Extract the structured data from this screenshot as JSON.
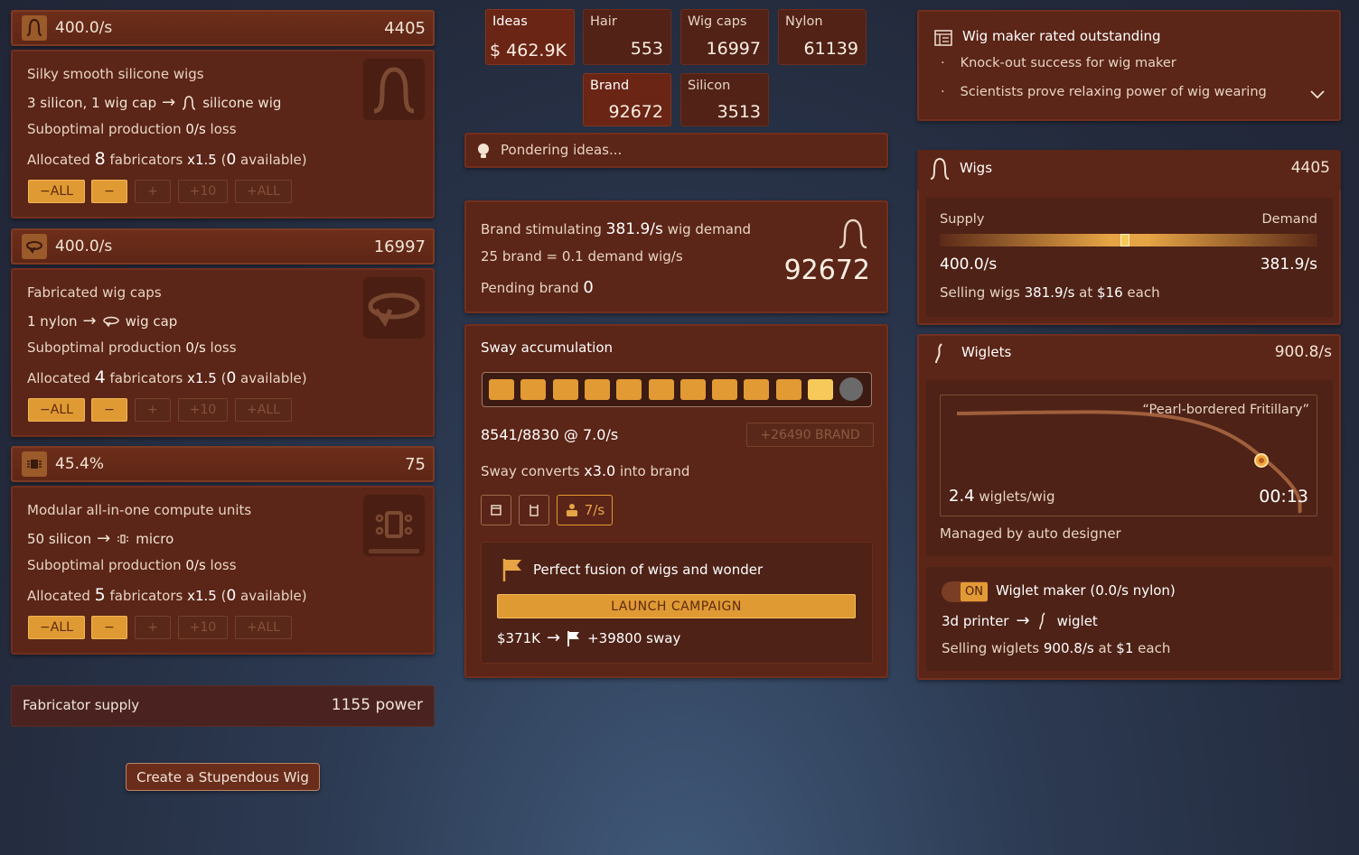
{
  "silicone": {
    "rate": "400.0/s",
    "count": "4405",
    "title": "Silky smooth silicone wigs",
    "recipe_left": "3 silicon, 1 wig cap",
    "recipe_right": "silicone wig",
    "subopt_a": "Suboptimal production ",
    "subopt_b": "0/s",
    "subopt_c": " loss",
    "alloc_a": "Allocated ",
    "alloc_n": "8",
    "alloc_b": " fabricators ",
    "alloc_x": "x1.5",
    "alloc_c": " (",
    "alloc_av": "0",
    "alloc_d": " available)"
  },
  "wigcap": {
    "rate": "400.0/s",
    "count": "16997",
    "title": "Fabricated wig caps",
    "recipe_left": "1 nylon",
    "recipe_right": "wig cap",
    "subopt_a": "Suboptimal production ",
    "subopt_b": "0/s",
    "subopt_c": " loss",
    "alloc_a": "Allocated ",
    "alloc_n": "4",
    "alloc_b": " fabricators ",
    "alloc_x": "x1.5",
    "alloc_c": " (",
    "alloc_av": "0",
    "alloc_d": " available)"
  },
  "micro": {
    "rate": "45.4%",
    "count": "75",
    "title": "Modular all-in-one compute units",
    "recipe_left": "50 silicon",
    "recipe_right": "micro",
    "subopt_a": "Suboptimal production ",
    "subopt_b": "0/s",
    "subopt_c": " loss",
    "alloc_a": "Allocated ",
    "alloc_n": "5",
    "alloc_b": " fabricators ",
    "alloc_x": "x1.5",
    "alloc_c": " (",
    "alloc_av": "0",
    "alloc_d": " available)"
  },
  "buttons": {
    "minus_all": "−ALL",
    "minus": "−",
    "plus": "+",
    "plus10": "+10",
    "plus_all": "+ALL"
  },
  "fab_supply": {
    "label": "Fabricator supply",
    "value": "1155 power"
  },
  "create_wig": "Create a Stupendous Wig",
  "resources": {
    "ideas": {
      "label": "Ideas",
      "value": "$ 462.9K"
    },
    "hair": {
      "label": "Hair",
      "value": "553"
    },
    "wigcaps": {
      "label": "Wig caps",
      "value": "16997"
    },
    "nylon": {
      "label": "Nylon",
      "value": "61139"
    },
    "brand": {
      "label": "Brand",
      "value": "92672"
    },
    "silicon": {
      "label": "Silicon",
      "value": "3513"
    }
  },
  "pondering": "Pondering ideas...",
  "brand_panel": {
    "l1a": "Brand stimulating ",
    "l1b": "381.9/s",
    "l1c": " wig demand",
    "l2": "25 brand = 0.1 demand wig/s",
    "l3a": "Pending brand ",
    "l3b": "0",
    "big": "92672"
  },
  "sway": {
    "title": "Sway accumulation",
    "filled": 10,
    "total": 12,
    "progress": "8541/8830 @ 7.0/s",
    "brand_btn": "+26490 BRAND",
    "conv_a": "Sway converts ",
    "conv_b": "x3.0",
    "conv_c": " into brand",
    "rate_btn": "7/s"
  },
  "campaign": {
    "title": "Perfect fusion of wigs and wonder",
    "button": "LAUNCH CAMPAIGN",
    "cost": "$371K",
    "gain": "+39800 sway"
  },
  "news": {
    "title": "Wig maker rated outstanding",
    "items": [
      "Knock-out success for wig maker",
      "Scientists prove relaxing power of wig wearing"
    ]
  },
  "wigs": {
    "title": "Wigs",
    "count": "4405",
    "supply_label": "Supply",
    "demand_label": "Demand",
    "supply_val": "400.0/s",
    "demand_val": "381.9/s",
    "balance": 0.49,
    "sell_a": "Selling wigs ",
    "sell_b": "381.9/s",
    "sell_c": " at ",
    "sell_d": "$16",
    "sell_e": " each"
  },
  "wiglets": {
    "title": "Wiglets",
    "rate": "900.8/s",
    "design_name": "“Pearl-bordered Fritillary”",
    "per_wig_n": "2.4",
    "per_wig_l": " wiglets/wig",
    "timer": "00:13",
    "managed": "Managed by auto designer",
    "toggle": "ON",
    "maker": "Wiglet maker (0.0/s nylon)",
    "printer_left": "3d printer",
    "printer_right": "wiglet",
    "sell_a": "Selling wiglets ",
    "sell_b": "900.8/s",
    "sell_c": " at ",
    "sell_d": "$1",
    "sell_e": " each"
  },
  "colors": {
    "accent": "#e29a35",
    "panel": "#5b2517",
    "light": "#f7c95a"
  }
}
